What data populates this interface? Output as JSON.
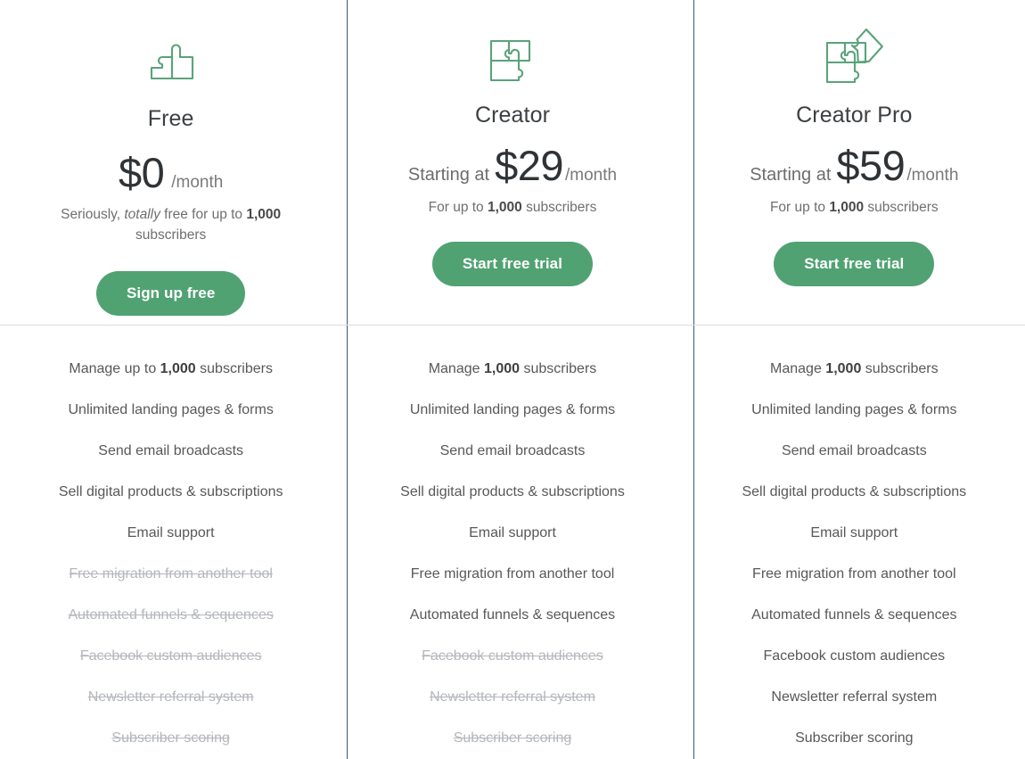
{
  "theme": {
    "accent_green": "#51a273",
    "icon_green": "#5aa37a",
    "divider_vertical": "#3f5a70",
    "divider_horizontal": "#dcdcdc",
    "text_primary": "#3c4043",
    "text_muted": "#6f6f6f",
    "text_disabled": "#b3b6bb"
  },
  "plans": [
    {
      "id": "free",
      "icon": "puzzle-two-pieces-icon",
      "name": "Free",
      "price_prefix": "",
      "price_amount": "$0",
      "price_period": "/month",
      "note_parts": [
        {
          "text": "Seriously, ",
          "style": "normal"
        },
        {
          "text": "totally",
          "style": "italic"
        },
        {
          "text": " free for up to ",
          "style": "normal"
        },
        {
          "text": "1,000",
          "style": "bold"
        },
        {
          "text": " subscribers",
          "style": "normal"
        }
      ],
      "cta_label": "Sign up free",
      "features": [
        {
          "text": "Manage up to 1,000 subscribers",
          "bold": "1,000",
          "included": true
        },
        {
          "text": "Unlimited landing pages & forms",
          "bold": "",
          "included": true
        },
        {
          "text": "Send email broadcasts",
          "bold": "",
          "included": true
        },
        {
          "text": "Sell digital products & subscriptions",
          "bold": "",
          "included": true
        },
        {
          "text": "Email support",
          "bold": "",
          "included": true
        },
        {
          "text": "Free migration from another tool",
          "bold": "",
          "included": false
        },
        {
          "text": "Automated funnels & sequences",
          "bold": "",
          "included": false
        },
        {
          "text": "Facebook custom audiences",
          "bold": "",
          "included": false
        },
        {
          "text": "Newsletter referral system",
          "bold": "",
          "included": false
        },
        {
          "text": "Subscriber scoring",
          "bold": "",
          "included": false
        }
      ]
    },
    {
      "id": "creator",
      "icon": "puzzle-three-pieces-icon",
      "name": "Creator",
      "price_prefix": "Starting at",
      "price_amount": "$29",
      "price_period": "/month",
      "note_parts": [
        {
          "text": "For up to ",
          "style": "normal"
        },
        {
          "text": "1,000",
          "style": "bold"
        },
        {
          "text": " subscribers",
          "style": "normal"
        }
      ],
      "cta_label": "Start free trial",
      "features": [
        {
          "text": "Manage 1,000 subscribers",
          "bold": "1,000",
          "included": true
        },
        {
          "text": "Unlimited landing pages & forms",
          "bold": "",
          "included": true
        },
        {
          "text": "Send email broadcasts",
          "bold": "",
          "included": true
        },
        {
          "text": "Sell digital products & subscriptions",
          "bold": "",
          "included": true
        },
        {
          "text": "Email support",
          "bold": "",
          "included": true
        },
        {
          "text": "Free migration from another tool",
          "bold": "",
          "included": true
        },
        {
          "text": "Automated funnels & sequences",
          "bold": "",
          "included": true
        },
        {
          "text": "Facebook custom audiences",
          "bold": "",
          "included": false
        },
        {
          "text": "Newsletter referral system",
          "bold": "",
          "included": false
        },
        {
          "text": "Subscriber scoring",
          "bold": "",
          "included": false
        }
      ]
    },
    {
      "id": "creator-pro",
      "icon": "puzzle-four-pieces-icon",
      "name": "Creator Pro",
      "price_prefix": "Starting at",
      "price_amount": "$59",
      "price_period": "/month",
      "note_parts": [
        {
          "text": "For up to ",
          "style": "normal"
        },
        {
          "text": "1,000",
          "style": "bold"
        },
        {
          "text": " subscribers",
          "style": "normal"
        }
      ],
      "cta_label": "Start free trial",
      "features": [
        {
          "text": "Manage 1,000 subscribers",
          "bold": "1,000",
          "included": true
        },
        {
          "text": "Unlimited landing pages & forms",
          "bold": "",
          "included": true
        },
        {
          "text": "Send email broadcasts",
          "bold": "",
          "included": true
        },
        {
          "text": "Sell digital products & subscriptions",
          "bold": "",
          "included": true
        },
        {
          "text": "Email support",
          "bold": "",
          "included": true
        },
        {
          "text": "Free migration from another tool",
          "bold": "",
          "included": true
        },
        {
          "text": "Automated funnels & sequences",
          "bold": "",
          "included": true
        },
        {
          "text": "Facebook custom audiences",
          "bold": "",
          "included": true
        },
        {
          "text": "Newsletter referral system",
          "bold": "",
          "included": true
        },
        {
          "text": "Subscriber scoring",
          "bold": "",
          "included": true
        }
      ]
    }
  ]
}
